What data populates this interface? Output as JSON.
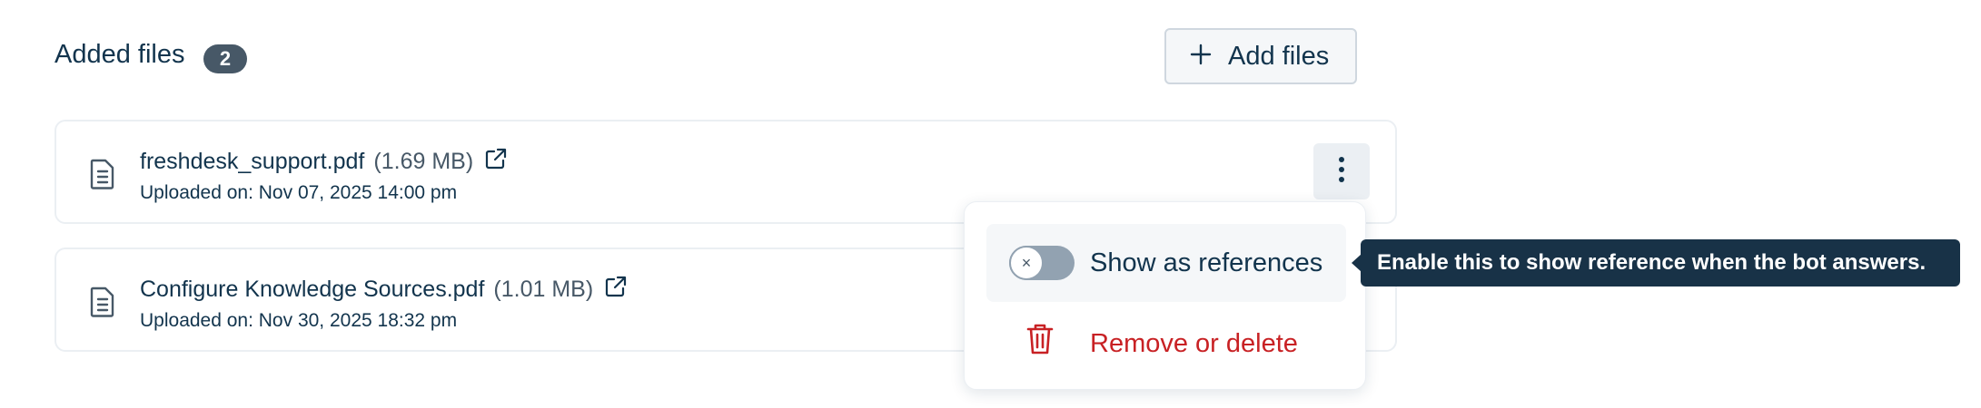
{
  "header": {
    "title": "Added files",
    "count": "2",
    "add_button_label": "Add files"
  },
  "files": [
    {
      "name": "freshdesk_support.pdf",
      "size": "(1.69 MB)",
      "uploaded": "Uploaded on: Nov 07, 2025 14:00 pm"
    },
    {
      "name": "Configure Knowledge Sources.pdf",
      "size": "(1.01 MB)",
      "uploaded": "Uploaded on: Nov 30, 2025 18:32 pm"
    }
  ],
  "menu": {
    "toggle_label": "Show as references",
    "toggle_state": "off",
    "delete_label": "Remove or delete"
  },
  "tooltip": {
    "text": "Enable this to show reference when the bot answers."
  },
  "colors": {
    "primary_text": "#12344d",
    "danger": "#c82124",
    "tooltip_bg": "#183247",
    "badge_bg": "#475867"
  },
  "icons": {
    "add": "plus-icon",
    "file": "document-icon",
    "external": "external-link-icon",
    "more": "kebab-menu-icon",
    "delete": "trash-icon"
  }
}
